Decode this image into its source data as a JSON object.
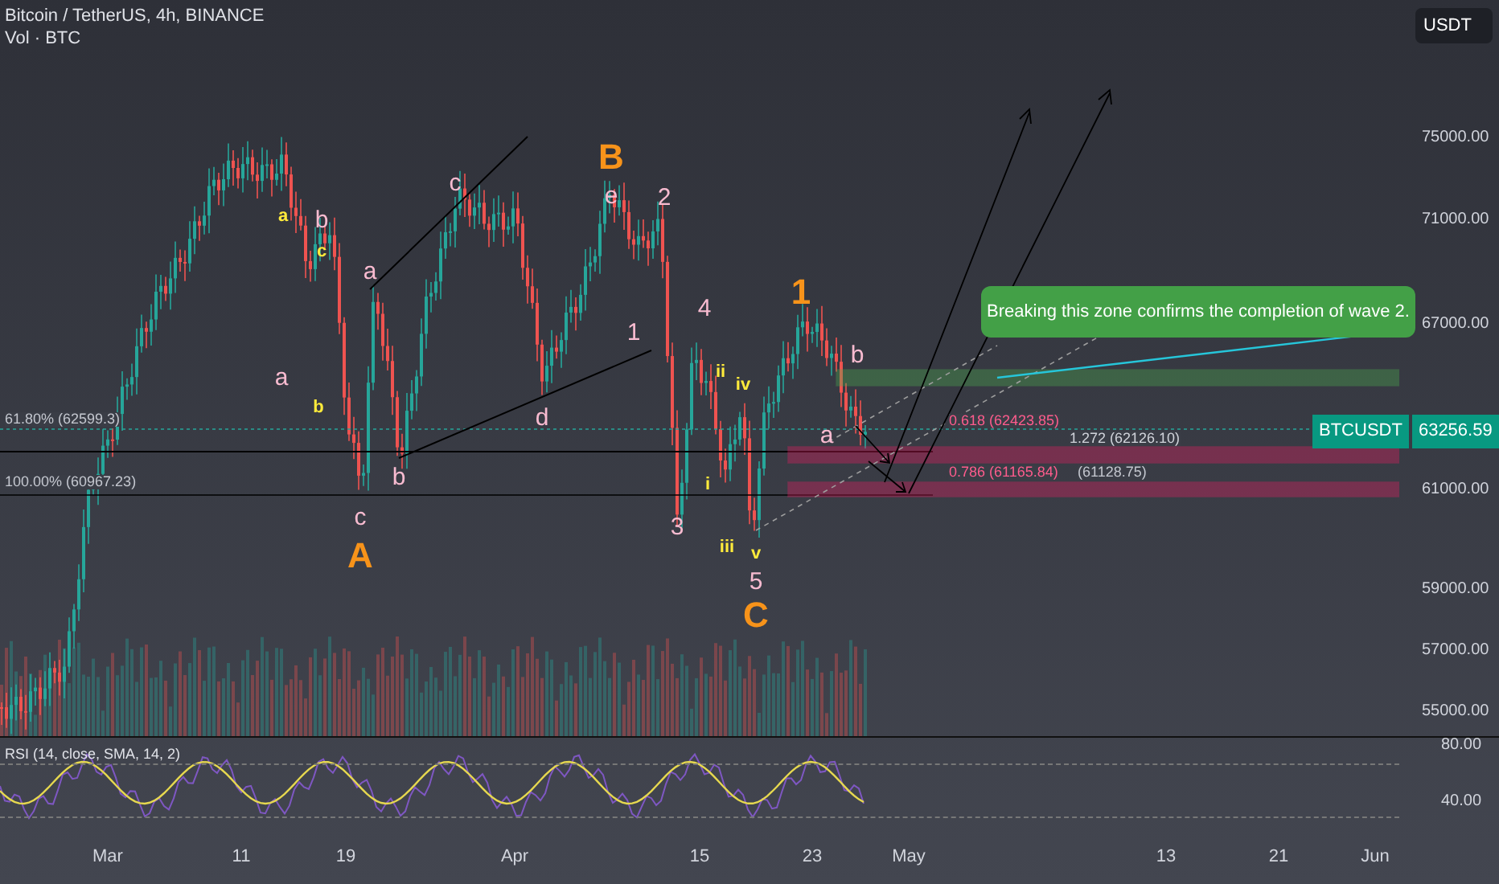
{
  "header": {
    "symbol": "Bitcoin / TetherUS, 4h, BINANCE",
    "volume_indicator": "Vol · BTC"
  },
  "currency": "USDT",
  "wave_labels": [
    {
      "text": "B",
      "color": "#f7931a",
      "kind": "major"
    },
    {
      "text": "e",
      "color": "#f8bbd0",
      "kind": "minor"
    },
    {
      "text": "c",
      "color": "#f8bbd0",
      "kind": "minor"
    },
    {
      "text": "2",
      "color": "#f8bbd0",
      "kind": "minor"
    },
    {
      "text": "a",
      "color": "#ffeb3b",
      "kind": "small"
    },
    {
      "text": "b",
      "color": "#f8bbd0",
      "kind": "minor"
    },
    {
      "text": "c",
      "color": "#ffeb3b",
      "kind": "small"
    },
    {
      "text": "a",
      "color": "#f8bbd0",
      "kind": "minor"
    },
    {
      "text": "4",
      "color": "#f8bbd0",
      "kind": "minor"
    },
    {
      "text": "1",
      "color": "#f7931a",
      "kind": "major"
    },
    {
      "text": "1",
      "color": "#f8bbd0",
      "kind": "minor"
    },
    {
      "text": "a",
      "color": "#f8bbd0",
      "kind": "minor"
    },
    {
      "text": "ii",
      "color": "#ffeb3b",
      "kind": "small"
    },
    {
      "text": "iv",
      "color": "#ffeb3b",
      "kind": "small"
    },
    {
      "text": "b",
      "color": "#f8bbd0",
      "kind": "minor"
    },
    {
      "text": "b",
      "color": "#ffeb3b",
      "kind": "small"
    },
    {
      "text": "d",
      "color": "#f8bbd0",
      "kind": "minor"
    },
    {
      "text": "a",
      "color": "#f8bbd0",
      "kind": "minor"
    },
    {
      "text": "b",
      "color": "#f8bbd0",
      "kind": "minor"
    },
    {
      "text": "i",
      "color": "#ffeb3b",
      "kind": "small"
    },
    {
      "text": "c",
      "color": "#f8bbd0",
      "kind": "minor"
    },
    {
      "text": "3",
      "color": "#f8bbd0",
      "kind": "minor"
    },
    {
      "text": "A",
      "color": "#f7931a",
      "kind": "major"
    },
    {
      "text": "iii",
      "color": "#ffeb3b",
      "kind": "small"
    },
    {
      "text": "v",
      "color": "#ffeb3b",
      "kind": "small"
    },
    {
      "text": "5",
      "color": "#f8bbd0",
      "kind": "minor"
    },
    {
      "text": "C",
      "color": "#f7931a",
      "kind": "major"
    }
  ],
  "fib_levels": [
    {
      "text": "61.80% (62599.3)",
      "kind": "faint"
    },
    {
      "text": "100.00% (60967.23)",
      "kind": "faint"
    },
    {
      "text": "0.618 (62423.85)",
      "kind": "pink"
    },
    {
      "text": "1.272 (62126.10)",
      "kind": "grey"
    },
    {
      "text": "0.786 (61165.84)",
      "kind": "pink"
    },
    {
      "text": "(61128.75)",
      "kind": "dark"
    }
  ],
  "callout": {
    "text": "Breaking this zone confirms the completion of wave 2."
  },
  "price_tag": {
    "symbol": "BTCUSDT",
    "price": "63256.59"
  },
  "price_axis": [
    "75000.00",
    "71000.00",
    "67000.00",
    "61000.00",
    "59000.00",
    "57000.00",
    "55000.00"
  ],
  "rsi": {
    "title": "RSI (14, close, SMA, 14, 2)",
    "axis": [
      "80.00",
      "40.00"
    ]
  },
  "time_axis": [
    "Mar",
    "11",
    "19",
    "Apr",
    "15",
    "23",
    "May",
    "13",
    "21",
    "Jun"
  ]
}
